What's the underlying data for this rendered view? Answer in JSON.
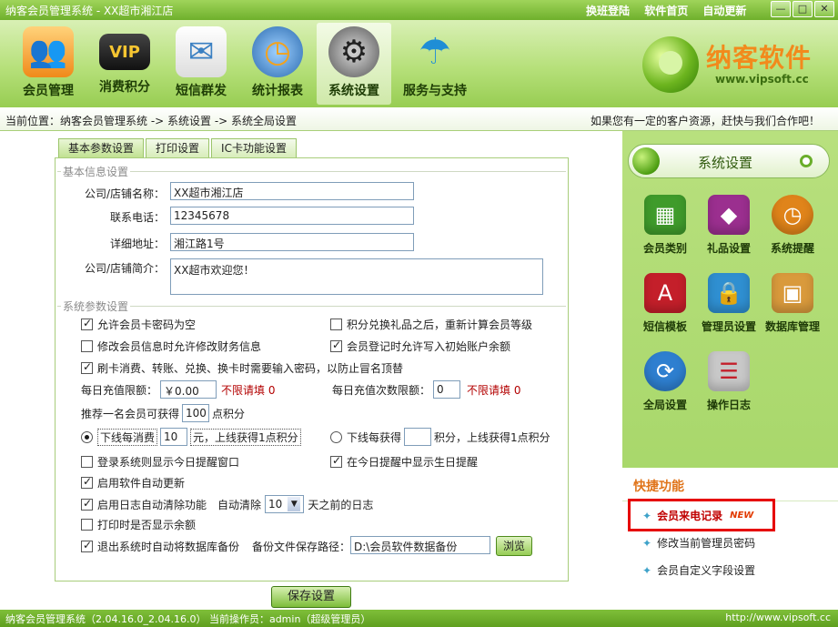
{
  "window": {
    "title": "纳客会员管理系统 - XX超市湘江店",
    "links": [
      "换班登陆",
      "软件首页",
      "自动更新"
    ],
    "controls": [
      "—",
      "□",
      "✕"
    ]
  },
  "nav": [
    {
      "label": "会员管理",
      "icon": "members-icon"
    },
    {
      "label": "消费积分",
      "icon": "vip-card-icon"
    },
    {
      "label": "短信群发",
      "icon": "sms-icon"
    },
    {
      "label": "统计报表",
      "icon": "clock-report-icon"
    },
    {
      "label": "系统设置",
      "icon": "gears-icon"
    },
    {
      "label": "服务与支持",
      "icon": "umbrella-icon"
    }
  ],
  "logo": {
    "name": "纳客软件",
    "url": "www.vipsoft.cc"
  },
  "breadcrumb": "当前位置：纳客会员管理系统 -> 系统设置 -> 系统全局设置",
  "promo": "如果您有一定的客户资源，赶快与我们合作吧！",
  "tabs": [
    "基本参数设置",
    "打印设置",
    "IC卡功能设置"
  ],
  "basic": {
    "section_title": "基本信息设置",
    "store_name_label": "公司/店铺名称：",
    "store_name": "XX超市湘江店",
    "phone_label": "联系电话：",
    "phone": "12345678",
    "address_label": "详细地址：",
    "address": "湘江路1号",
    "intro_label": "公司/店铺简介：",
    "intro": "XX超市欢迎您！"
  },
  "params": {
    "section_title": "系统参数设置",
    "allow_empty_pwd": "允许会员卡密码为空",
    "recalc_level": "积分兑换礼品之后，重新计算会员等级",
    "edit_finance": "修改会员信息时允许修改财务信息",
    "init_balance": "会员登记时允许写入初始账户余额",
    "pwd_on_card": "刷卡消费、转账、兑换、换卡时需要输入密码，以防止冒名顶替",
    "daily_limit_label": "每日充值限额：",
    "daily_limit": "￥0.00",
    "daily_limit_hint": "不限请填 0",
    "daily_count_label": "每日充值次数限额：",
    "daily_count": "0",
    "daily_count_hint": "不限请填 0",
    "recommend_pre": "推荐一名会员可获得",
    "recommend_val": "100",
    "recommend_post": "点积分",
    "downline_spend_pre": "下线每消费",
    "downline_spend_val": "10",
    "downline_spend_post": "元，上线获得1点积分",
    "downline_get_pre": "下线每获得",
    "downline_get_val": "",
    "downline_get_post": "积分，上线获得1点积分",
    "show_reminder": "登录系统则显示今日提醒窗口",
    "birthday_reminder": "在今日提醒中显示生日提醒",
    "auto_update": "启用软件自动更新",
    "log_cleanup": "启用日志自动清除功能",
    "auto_clean_label": "自动清除",
    "auto_clean_days": "10",
    "auto_clean_post": "天之前的日志",
    "print_balance": "打印时是否显示余额",
    "auto_backup": "退出系统时自动将数据库备份",
    "backup_path_label": "备份文件保存路径：",
    "backup_path": "D:\\会员软件数据备份",
    "browse": "浏览"
  },
  "save": "保存设置",
  "sidebar": {
    "title": "系统设置",
    "items": [
      {
        "label": "会员类别",
        "icon": "member-category-icon",
        "color": "#3f9b2b"
      },
      {
        "label": "礼品设置",
        "icon": "gift-icon",
        "color": "#9b2f8f"
      },
      {
        "label": "系统提醒",
        "icon": "alarm-clock-icon",
        "color": "#e0841a"
      },
      {
        "label": "短信模板",
        "icon": "sms-template-icon",
        "color": "#c41f2a"
      },
      {
        "label": "管理员设置",
        "icon": "admin-lock-icon",
        "color": "#2f8fd1"
      },
      {
        "label": "数据库管理",
        "icon": "database-icon",
        "color": "#d99a3c"
      },
      {
        "label": "全局设置",
        "icon": "global-settings-icon",
        "color": "#2e7fd0"
      },
      {
        "label": "操作日志",
        "icon": "operation-log-icon",
        "color": "#c8c8c8"
      }
    ]
  },
  "quick": {
    "title": "快捷功能",
    "items": [
      "会员来电记录",
      "修改当前管理员密码",
      "会员自定义字段设置"
    ],
    "new_badge": "NEW"
  },
  "status": {
    "left": "纳客会员管理系统（2.04.16.0_2.04.16.0） 当前操作员：admin（超级管理员）",
    "right": "http://www.vipsoft.cc"
  }
}
